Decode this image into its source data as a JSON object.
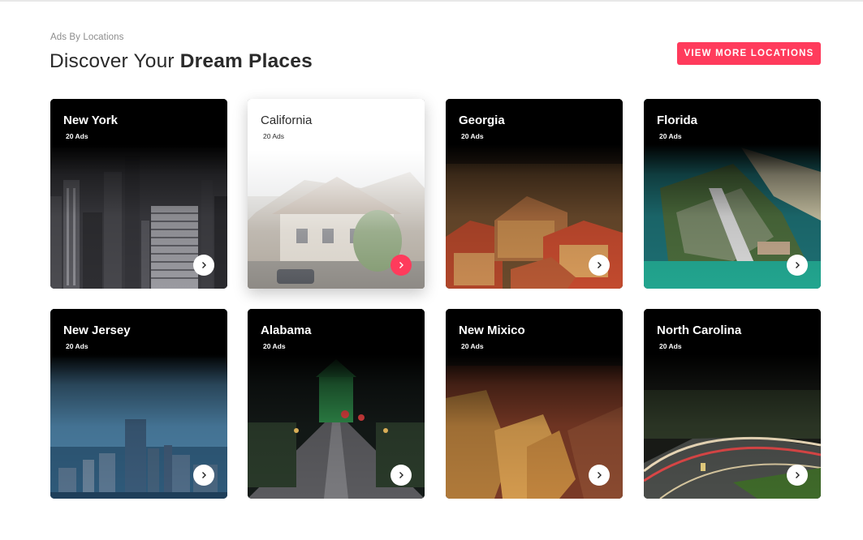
{
  "section": {
    "eyebrow": "Ads By Locations",
    "title_light": "Discover Your",
    "title_strong": "Dream Places",
    "view_more_label": "VIEW MORE LOCATIONS"
  },
  "colors": {
    "accent": "#ff3b5c",
    "text_dark": "#2a2a2a",
    "text_muted": "#8c8c8c"
  },
  "locations": [
    {
      "name": "New York",
      "ads": "20 Ads",
      "arrow_icon": "chevron-right-icon"
    },
    {
      "name": "California",
      "ads": "20 Ads",
      "arrow_icon": "chevron-right-icon",
      "state": "highlighted"
    },
    {
      "name": "Georgia",
      "ads": "20 Ads",
      "arrow_icon": "chevron-right-icon"
    },
    {
      "name": "Florida",
      "ads": "20 Ads",
      "arrow_icon": "chevron-right-icon"
    },
    {
      "name": "New Jersey",
      "ads": "20 Ads",
      "arrow_icon": "chevron-right-icon"
    },
    {
      "name": "Alabama",
      "ads": "20 Ads",
      "arrow_icon": "chevron-right-icon"
    },
    {
      "name": "New Mixico",
      "ads": "20 Ads",
      "arrow_icon": "chevron-right-icon"
    },
    {
      "name": "North Carolina",
      "ads": "20 Ads",
      "arrow_icon": "chevron-right-icon"
    }
  ]
}
